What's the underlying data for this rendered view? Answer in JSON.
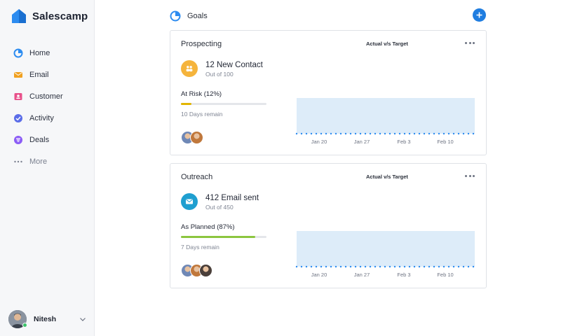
{
  "app": {
    "name": "Salescamp",
    "brand_color": "#1f7de0"
  },
  "sidebar": {
    "items": [
      {
        "label": "Home",
        "icon": "home-pie-icon",
        "color": "#2d8cf0"
      },
      {
        "label": "Email",
        "icon": "email-icon",
        "color": "#f0a020"
      },
      {
        "label": "Customer",
        "icon": "customer-icon",
        "color": "#e8508a"
      },
      {
        "label": "Activity",
        "icon": "activity-check-icon",
        "color": "#5b6de8"
      },
      {
        "label": "Deals",
        "icon": "deals-icon",
        "color": "#8b5cf6"
      },
      {
        "label": "More",
        "icon": "more-dots-icon",
        "color": "#7b8190"
      }
    ],
    "user": {
      "name": "Nitesh",
      "status": "online"
    }
  },
  "header": {
    "title": "Goals",
    "add_icon": "plus-icon"
  },
  "goals": [
    {
      "title": "Prospecting",
      "legend": "Actual v/s Target",
      "icon": "people-icon",
      "icon_color": "#f5b43c",
      "main": "12 New Contact",
      "sub": "Out of 100",
      "status": "At Risk  (12%)",
      "progress": 0.12,
      "progress_color": "#e2b500",
      "remain": "10 Days remain",
      "avatars": [
        "#6f88b6",
        "#c0783c"
      ],
      "chart_data": {
        "type": "area",
        "categories": [
          "Jan 20",
          "Jan 27",
          "Feb 3",
          "Feb 10"
        ],
        "series": [
          {
            "values": [
              100,
              100,
              100,
              100
            ]
          },
          {
            "values": [
              0,
              0,
              0,
              0
            ]
          }
        ]
      }
    },
    {
      "title": "Outreach",
      "legend": "Actual v/s Target",
      "icon": "mail-icon",
      "icon_color": "#1f9fd0",
      "main": "412 Email sent",
      "sub": "Out of 450",
      "status": "As Planned  (87%)",
      "progress": 0.87,
      "progress_color": "#8cc63f",
      "remain": "7 Days remain",
      "avatars": [
        "#6f88b6",
        "#c0783c",
        "#4a3f3a"
      ],
      "chart_data": {
        "type": "area",
        "categories": [
          "Jan 20",
          "Jan 27",
          "Feb 3",
          "Feb 10"
        ],
        "series": [
          {
            "values": [
              100,
              100,
              100,
              100
            ]
          },
          {
            "values": [
              0,
              0,
              0,
              0
            ]
          }
        ]
      }
    }
  ]
}
